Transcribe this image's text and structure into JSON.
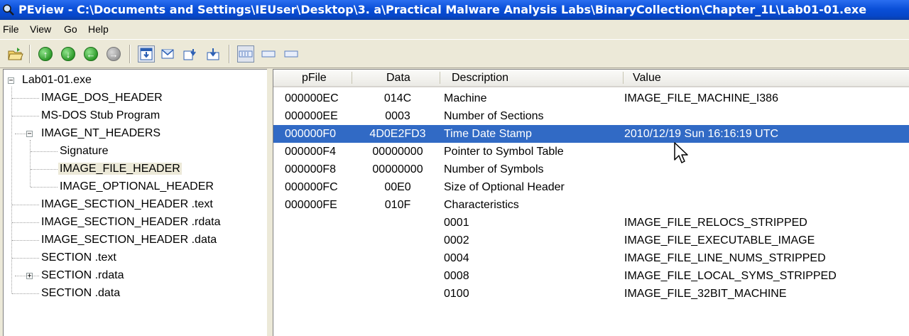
{
  "window": {
    "title": "PEview - C:\\Documents and Settings\\IEUser\\Desktop\\3. a\\Practical Malware Analysis Labs\\BinaryCollection\\Chapter_1L\\Lab01-01.exe"
  },
  "menu": [
    "File",
    "View",
    "Go",
    "Help"
  ],
  "toolbar": {
    "buttons": [
      "open-icon",
      "up-icon",
      "down-icon",
      "back-icon",
      "forward-icon",
      "view-byte-icon",
      "view-word-icon",
      "view-dword-icon",
      "view-qword-icon",
      "address-file-offset-icon",
      "address-rva-icon",
      "address-va-icon"
    ]
  },
  "tree": [
    {
      "label": "Lab01-01.exe",
      "expander": "−"
    },
    {
      "label": "IMAGE_DOS_HEADER"
    },
    {
      "label": "MS-DOS Stub Program"
    },
    {
      "label": "IMAGE_NT_HEADERS",
      "expander": "−"
    },
    {
      "label": "Signature"
    },
    {
      "label": "IMAGE_FILE_HEADER",
      "selected": true
    },
    {
      "label": "IMAGE_OPTIONAL_HEADER"
    },
    {
      "label": "IMAGE_SECTION_HEADER .text"
    },
    {
      "label": "IMAGE_SECTION_HEADER .rdata"
    },
    {
      "label": "IMAGE_SECTION_HEADER .data"
    },
    {
      "label": "SECTION .text"
    },
    {
      "label": "SECTION .rdata",
      "expander": "+"
    },
    {
      "label": "SECTION .data"
    }
  ],
  "table": {
    "columns": [
      "pFile",
      "Data",
      "Description",
      "Value"
    ],
    "rows": [
      [
        "000000EC",
        "014C",
        "Machine",
        "IMAGE_FILE_MACHINE_I386"
      ],
      [
        "000000EE",
        "0003",
        "Number of Sections",
        ""
      ],
      [
        "000000F0",
        "4D0E2FD3",
        "Time Date Stamp",
        "2010/12/19 Sun 16:16:19 UTC"
      ],
      [
        "000000F4",
        "00000000",
        "Pointer to Symbol Table",
        ""
      ],
      [
        "000000F8",
        "00000000",
        "Number of Symbols",
        ""
      ],
      [
        "000000FC",
        "00E0",
        "Size of Optional Header",
        ""
      ],
      [
        "000000FE",
        "010F",
        "Characteristics",
        ""
      ],
      [
        "",
        "",
        "0001",
        "IMAGE_FILE_RELOCS_STRIPPED"
      ],
      [
        "",
        "",
        "0002",
        "IMAGE_FILE_EXECUTABLE_IMAGE"
      ],
      [
        "",
        "",
        "0004",
        "IMAGE_FILE_LINE_NUMS_STRIPPED"
      ],
      [
        "",
        "",
        "0008",
        "IMAGE_FILE_LOCAL_SYMS_STRIPPED"
      ],
      [
        "",
        "",
        "0100",
        "IMAGE_FILE_32BIT_MACHINE"
      ]
    ],
    "selected_row": 2
  },
  "colors": {
    "selection": "#316ac5",
    "titlebar": "#0a4fd8"
  }
}
